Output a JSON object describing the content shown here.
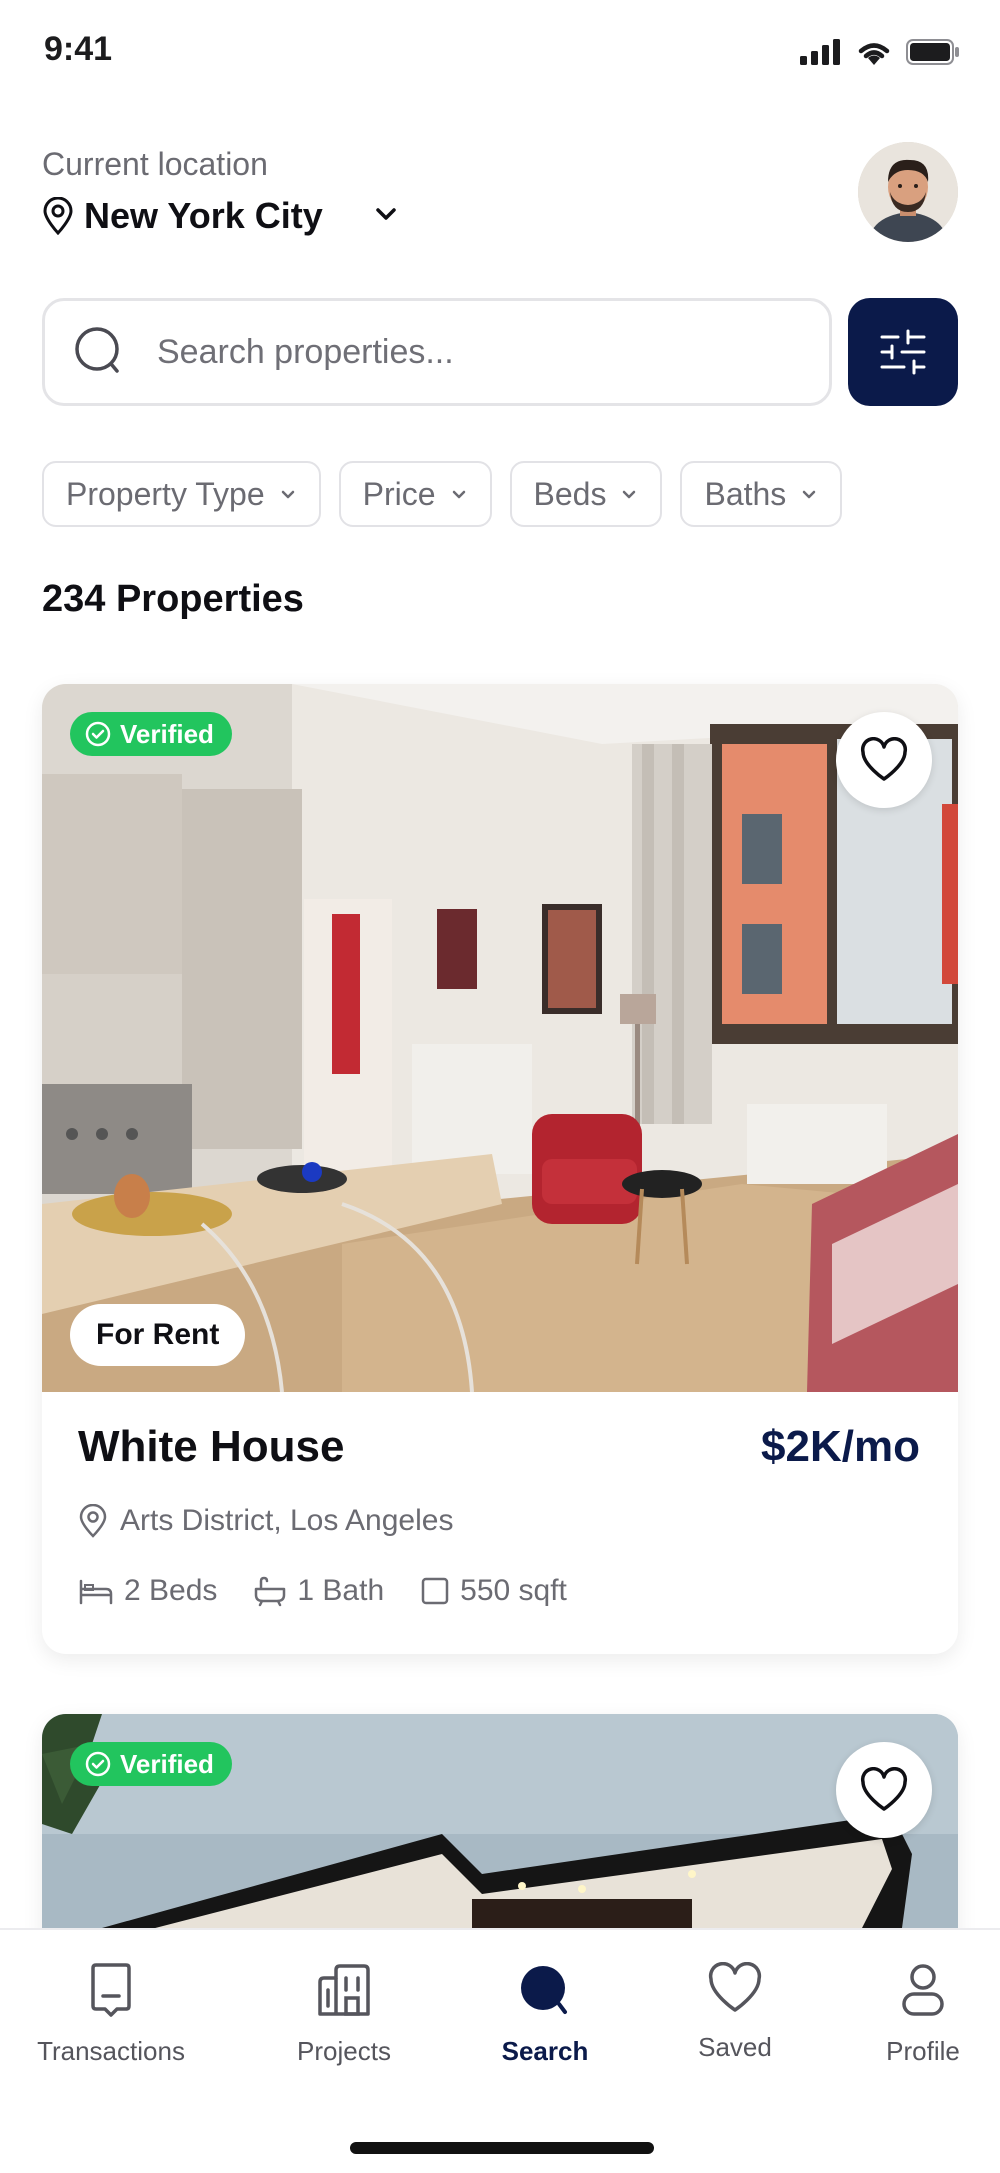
{
  "status_bar": {
    "time": "9:41"
  },
  "header": {
    "location_label": "Current location",
    "city": "New York City"
  },
  "search": {
    "placeholder": "Search properties..."
  },
  "filters": [
    {
      "label": "Property Type"
    },
    {
      "label": "Price"
    },
    {
      "label": "Beds"
    },
    {
      "label": "Baths"
    }
  ],
  "results": {
    "count_label": "234 Properties"
  },
  "listings": [
    {
      "verified_label": "Verified",
      "status_label": "For Rent",
      "title": "White House",
      "price": "$2K/mo",
      "address": "Arts District, Los Angeles",
      "beds": "2 Beds",
      "baths": "1 Bath",
      "area": "550 sqft"
    },
    {
      "verified_label": "Verified"
    }
  ],
  "bottom_nav": [
    {
      "label": "Transactions",
      "icon": "receipt-icon"
    },
    {
      "label": "Projects",
      "icon": "building-icon"
    },
    {
      "label": "Search",
      "icon": "search-icon",
      "active": true
    },
    {
      "label": "Saved",
      "icon": "heart-icon"
    },
    {
      "label": "Profile",
      "icon": "user-icon"
    }
  ],
  "colors": {
    "primary": "#0b1a4a",
    "verified": "#22c55e",
    "muted_text": "#6b6b72"
  }
}
